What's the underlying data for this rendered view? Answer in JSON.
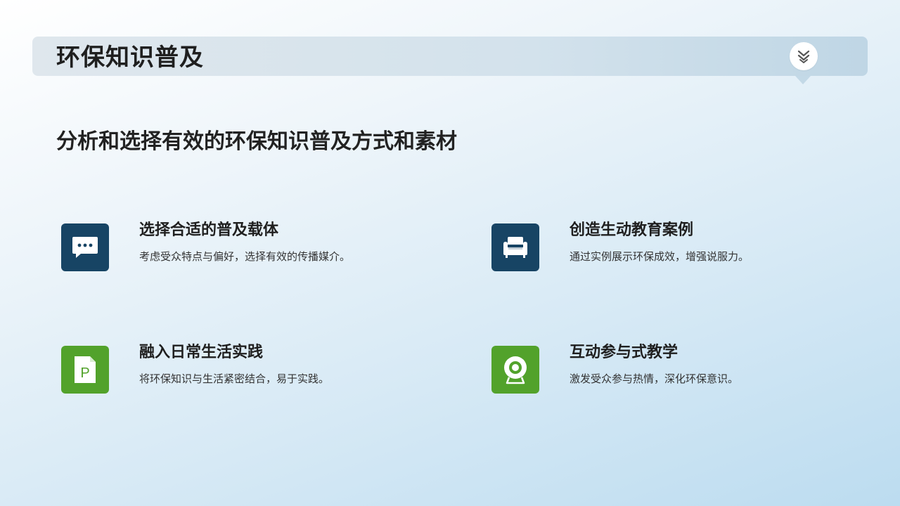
{
  "header": {
    "title": "环保知识普及",
    "menu_icon": "double-chevron-down-icon"
  },
  "subtitle": "分析和选择有效的环保知识普及方式和素材",
  "cards": [
    {
      "title": "选择合适的普及载体",
      "desc": "考虑受众特点与偏好，选择有效的传播媒介。",
      "icon": "chat-bubble-icon",
      "icon_bg": "#174464"
    },
    {
      "title": "创造生动教育案例",
      "desc": "通过实例展示环保成效，增强说服力。",
      "icon": "armchair-icon",
      "icon_bg": "#174464"
    },
    {
      "title": "融入日常生活实践",
      "desc": "将环保知识与生活紧密结合，易于实践。",
      "icon": "document-p-icon",
      "icon_bg": "#52a22b",
      "icon_glyph": "P"
    },
    {
      "title": "互动参与式教学",
      "desc": "激发受众参与热情，深化环保意识。",
      "icon": "webcam-icon",
      "icon_bg": "#52a22b"
    }
  ]
}
